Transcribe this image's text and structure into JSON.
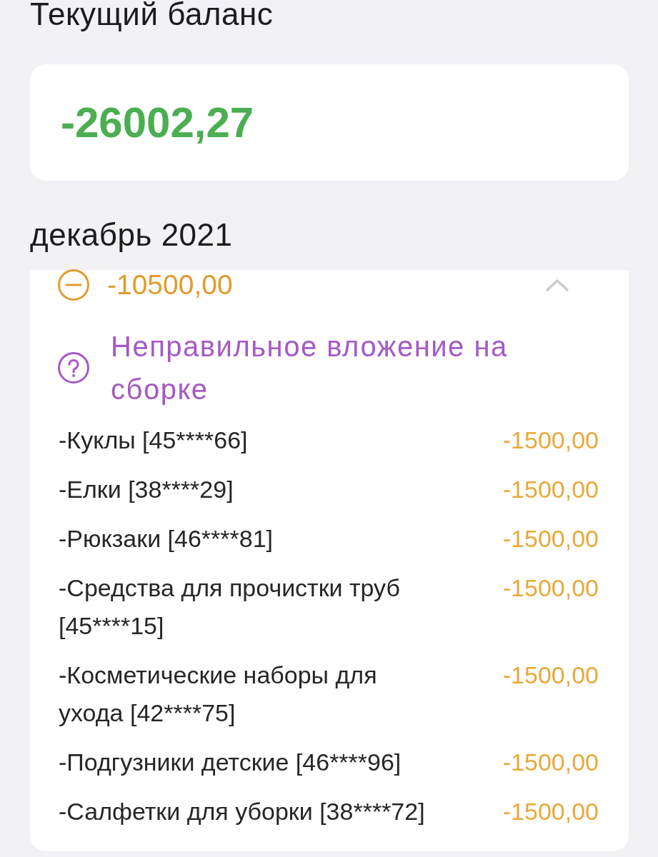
{
  "balance": {
    "title": "Текущий баланс",
    "amount": "-26002,27"
  },
  "month": {
    "title": "декабрь 2021",
    "groups": [
      {
        "amount": "-10500,00",
        "expanded": true,
        "reason": "Неправильное вложение на сборке",
        "items": [
          {
            "name": "-Куклы [45****66]",
            "amount": "-1500,00"
          },
          {
            "name": "-Елки [38****29]",
            "amount": "-1500,00"
          },
          {
            "name": "-Рюкзаки [46****81]",
            "amount": "-1500,00"
          },
          {
            "name": "-Средства для прочистки труб [45****15]",
            "amount": "-1500,00"
          },
          {
            "name": "-Косметические наборы для ухода [42****75]",
            "amount": "-1500,00"
          },
          {
            "name": "-Подгузники детские [46****96]",
            "amount": "-1500,00"
          },
          {
            "name": "-Салфетки для уборки [38****72]",
            "amount": "-1500,00"
          }
        ]
      }
    ]
  }
}
